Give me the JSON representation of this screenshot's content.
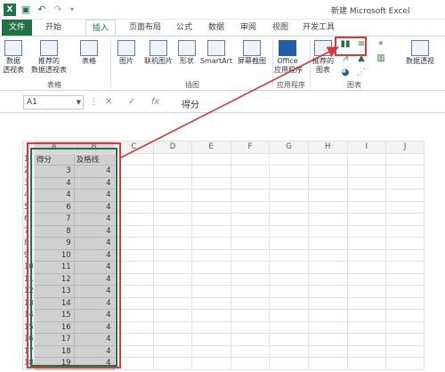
{
  "window": {
    "title": "新建 Microsoft Excel"
  },
  "tabs": [
    {
      "label": "文件",
      "key": "file"
    },
    {
      "label": "开始",
      "key": "home"
    },
    {
      "label": "插入",
      "key": "insert"
    },
    {
      "label": "页面布局",
      "key": "layout"
    },
    {
      "label": "公式",
      "key": "formulas"
    },
    {
      "label": "数据",
      "key": "data"
    },
    {
      "label": "审阅",
      "key": "review"
    },
    {
      "label": "视图",
      "key": "view"
    },
    {
      "label": "开发工具",
      "key": "developer"
    }
  ],
  "ribbon": {
    "pivot_table": "数据\n透视表",
    "recommended_pivot": "推荐的\n数据透视表",
    "table": "表格",
    "group_tables": "表格",
    "picture": "图片",
    "online_picture": "联机图片",
    "shapes": "形状",
    "smartart": "SmartArt",
    "screenshot": "屏幕截图",
    "group_illustrations": "插图",
    "office_apps": "Office\n应用程序",
    "group_apps": "应用程序",
    "recommended_charts": "推荐的\n图表",
    "pivot_chart": "数据透视",
    "group_charts": "图表"
  },
  "formula_bar": {
    "cell_ref": "A1",
    "fx": "fx",
    "value": "得分"
  },
  "columns": [
    "A",
    "B",
    "C",
    "D",
    "E",
    "F",
    "G",
    "H",
    "I",
    "J"
  ],
  "rows": [
    {
      "n": "1",
      "a": "得分",
      "b": "及格线"
    },
    {
      "n": "2",
      "a": "3",
      "b": "4"
    },
    {
      "n": "3",
      "a": "4",
      "b": "4"
    },
    {
      "n": "4",
      "a": "4",
      "b": "4"
    },
    {
      "n": "5",
      "a": "6",
      "b": "4"
    },
    {
      "n": "6",
      "a": "7",
      "b": "4"
    },
    {
      "n": "7",
      "a": "8",
      "b": "4"
    },
    {
      "n": "8",
      "a": "9",
      "b": "4"
    },
    {
      "n": "9",
      "a": "10",
      "b": "4"
    },
    {
      "n": "10",
      "a": "11",
      "b": "4"
    },
    {
      "n": "11",
      "a": "12",
      "b": "4"
    },
    {
      "n": "12",
      "a": "13",
      "b": "4"
    },
    {
      "n": "13",
      "a": "14",
      "b": "4"
    },
    {
      "n": "14",
      "a": "15",
      "b": "4"
    },
    {
      "n": "15",
      "a": "16",
      "b": "4"
    },
    {
      "n": "16",
      "a": "17",
      "b": "4"
    },
    {
      "n": "17",
      "a": "18",
      "b": "4"
    },
    {
      "n": "18",
      "a": "19",
      "b": "4"
    }
  ],
  "colors": {
    "excel_green": "#217346",
    "annotation_red": "#d63a3a",
    "selection_fill": "#d0d0d0"
  },
  "icons": {
    "save": "save-icon",
    "undo": "undo-icon",
    "redo": "redo-icon",
    "cancel": "cancel-icon",
    "enter": "check-icon"
  }
}
